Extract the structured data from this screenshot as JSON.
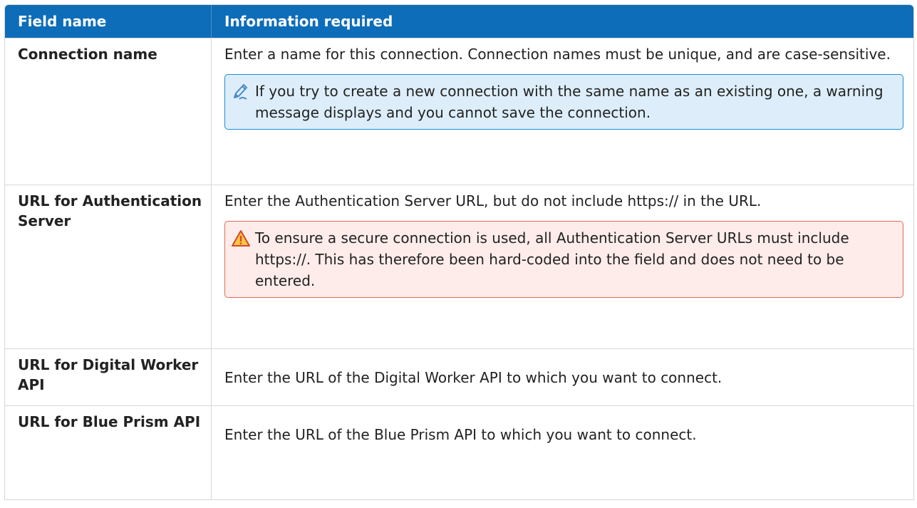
{
  "header": {
    "col1": "Field name",
    "col2": "Information required"
  },
  "rows": [
    {
      "field": "Connection name",
      "info": "Enter a name for this connection. Connection names must be unique, and are case-sensitive.",
      "note": {
        "type": "info",
        "icon": "pencil-icon",
        "text": "If you try to create a new connection with the same name as an existing one, a warning message displays and you cannot save the connection."
      }
    },
    {
      "field": "URL for Authentication Server",
      "info": "Enter the Authentication Server URL, but do not include https:// in the URL.",
      "note": {
        "type": "warning",
        "icon": "warning-icon",
        "text": "To ensure a secure connection is used, all Authentication Server URLs must include https://. This has therefore been hard-coded into the field and does not need to be entered."
      }
    },
    {
      "field": "URL for Digital Worker API",
      "info": "Enter the URL of the Digital Worker API to which you want to connect."
    },
    {
      "field": "URL for Blue Prism API",
      "info": "Enter the URL of the Blue Prism API to which you want to connect."
    }
  ],
  "colors": {
    "header_bg": "#0d6db8",
    "info_bg": "#ddeefa",
    "info_border": "#1c8ed6",
    "warn_bg": "#fdecea",
    "warn_border": "#e26a55"
  }
}
